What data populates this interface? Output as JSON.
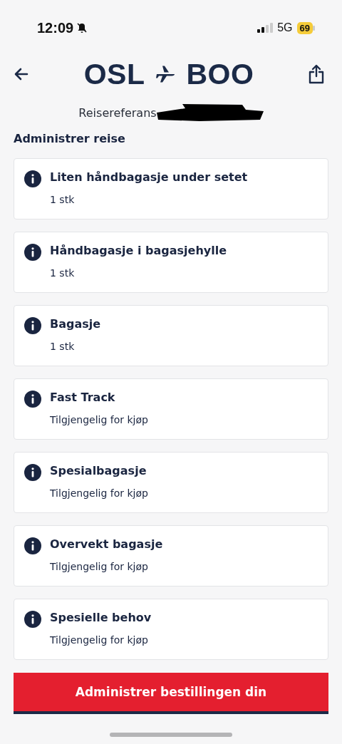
{
  "status_bar": {
    "time": "12:09",
    "network": "5G",
    "battery": "69"
  },
  "header": {
    "origin": "OSL",
    "destination": "BOO",
    "reference_label": "Reisereferans"
  },
  "section_title": "Administrer reise",
  "items": [
    {
      "title": "Liten håndbagasje under setet",
      "detail": "1 stk"
    },
    {
      "title": "Håndbagasje i bagasjehylle",
      "detail": "1 stk"
    },
    {
      "title": "Bagasje",
      "detail": "1 stk"
    },
    {
      "title": "Fast Track",
      "detail": "Tilgjengelig for kjøp"
    },
    {
      "title": "Spesialbagasje",
      "detail": "Tilgjengelig for kjøp"
    },
    {
      "title": "Overvekt bagasje",
      "detail": "Tilgjengelig for kjøp"
    },
    {
      "title": "Spesielle behov",
      "detail": "Tilgjengelig for kjøp"
    }
  ],
  "primary_button": "Administrer bestillingen din"
}
